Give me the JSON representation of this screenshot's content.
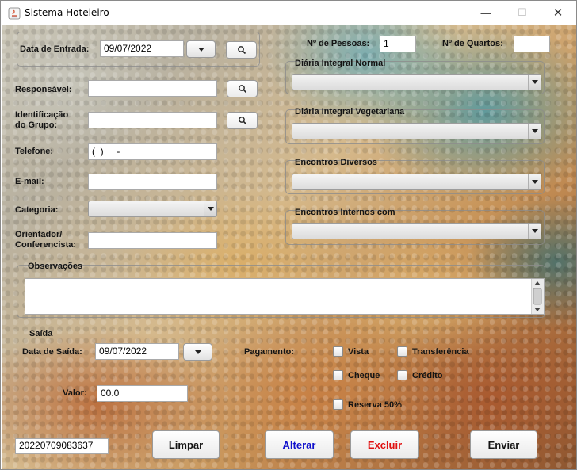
{
  "window": {
    "title": "Sistema Hoteleiro",
    "minimize": "—",
    "maximize": "☐",
    "close": "✕"
  },
  "entrada": {
    "label": "Data de Entrada:",
    "date": "09/07/2022"
  },
  "form": {
    "responsavel_label": "Responsável:",
    "identificacao_label_1": "Identificação",
    "identificacao_label_2": "do Grupo:",
    "telefone_label": "Telefone:",
    "telefone_value": "(  )     -",
    "email_label": "E-mail:",
    "categoria_label": "Categoria:",
    "orientador_label_1": "Orientador/",
    "orientador_label_2": "Conferencista:"
  },
  "right": {
    "pessoas_label": "Nº de Pessoas:",
    "pessoas_value": "1",
    "quartos_label": "Nº de Quartos:",
    "quartos_value": "",
    "diaria_normal": "Diária Integral Normal",
    "diaria_veg": "Diária Integral Vegetariana",
    "encontros_diversos": "Encontros Diversos",
    "encontros_internos": "Encontros Internos com"
  },
  "observacoes": {
    "label": "Observações",
    "value": ""
  },
  "saida": {
    "section_label": "Saída",
    "date_label": "Data de Saída:",
    "date": "09/07/2022",
    "valor_label": "Valor:",
    "valor_value": "00.0"
  },
  "pagamento": {
    "label": "Pagamento:",
    "vista": "Vista",
    "transferencia": "Transferência",
    "cheque": "Cheque",
    "credito": "Crédito",
    "reserva": "Reserva 50%"
  },
  "footer": {
    "code": "20220709083637",
    "limpar": "Limpar",
    "alterar": "Alterar",
    "excluir": "Excluir",
    "enviar": "Enviar"
  },
  "colors": {
    "alterar_text": "#1010cc",
    "excluir_text": "#e01010",
    "default_text": "#141414"
  }
}
